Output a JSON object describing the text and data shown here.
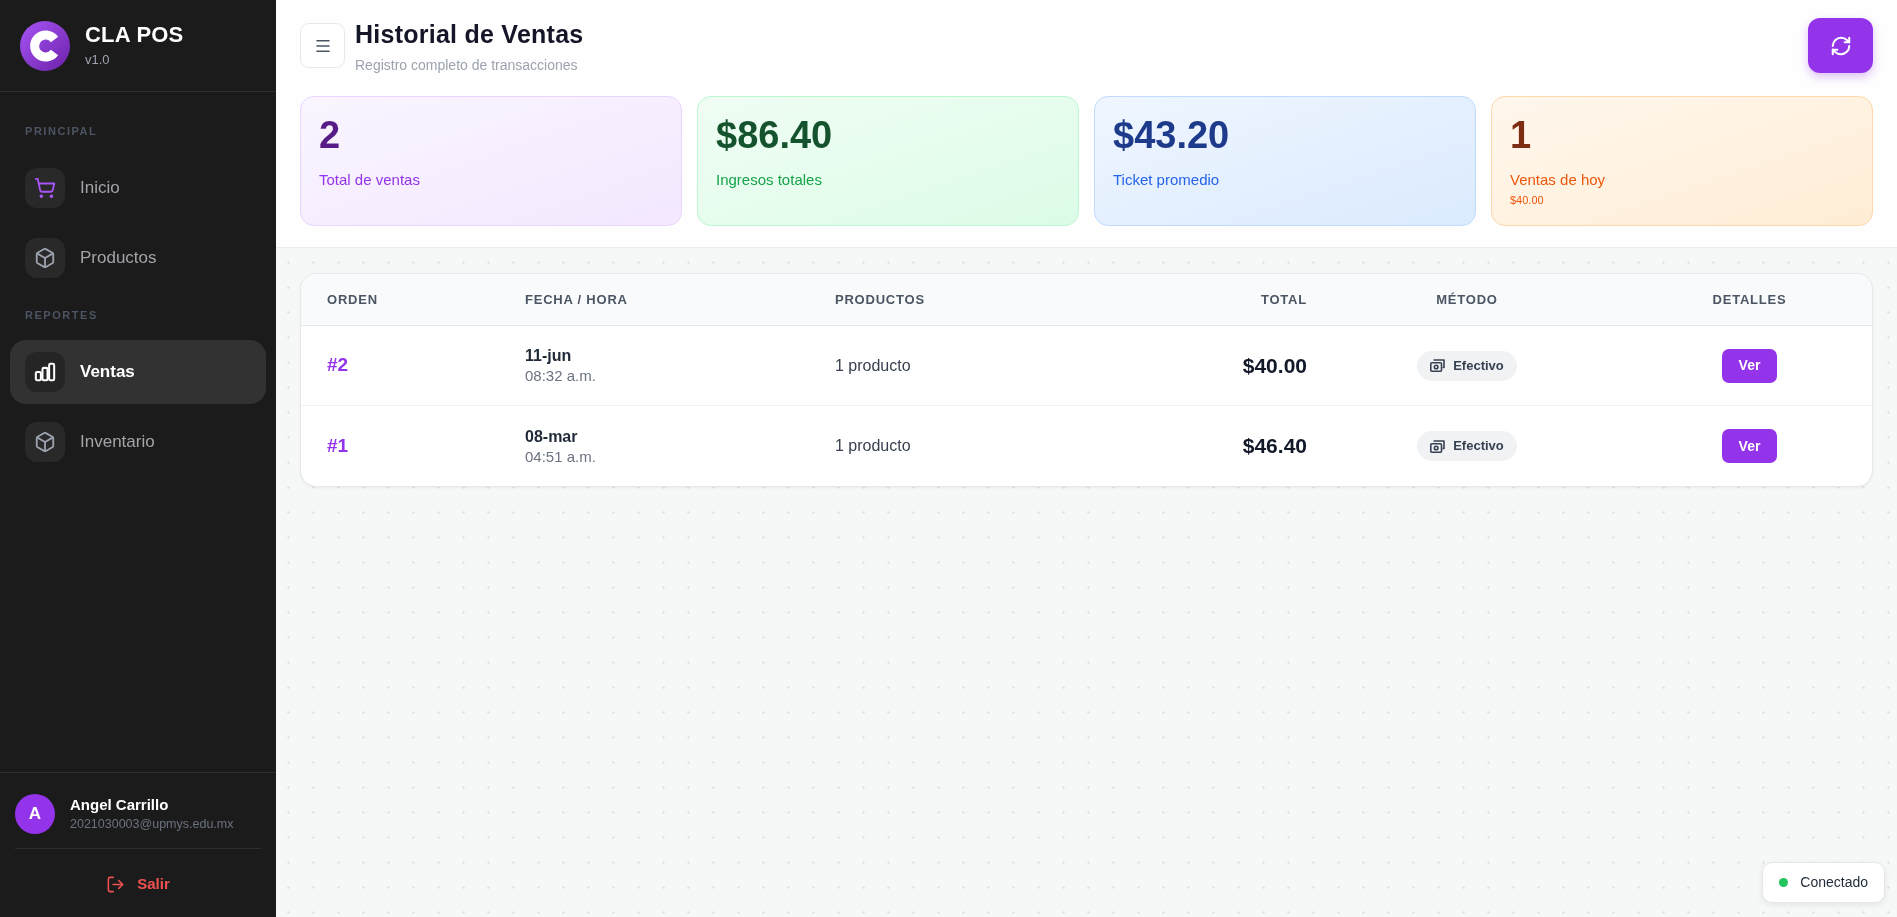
{
  "sidebar": {
    "brand": {
      "name": "CLA POS",
      "version": "v1.0"
    },
    "sections": [
      {
        "title": "PRINCIPAL",
        "items": [
          {
            "label": "Inicio",
            "selected": false
          },
          {
            "label": "Productos",
            "selected": false
          }
        ]
      },
      {
        "title": "REPORTES",
        "items": [
          {
            "label": "Ventas",
            "selected": true
          },
          {
            "label": "Inventario",
            "selected": false
          }
        ]
      }
    ],
    "user": {
      "initial": "A",
      "name": "Angel Carrillo",
      "email": "2021030003@upmys.edu.mx"
    },
    "logout": "Salir"
  },
  "header": {
    "title": "Historial de Ventas",
    "subtitle": "Registro completo de transacciones"
  },
  "stats": [
    {
      "value": "2",
      "label": "Total de ventas",
      "color": "#9333ea"
    },
    {
      "value": "$86.40",
      "label": "Ingresos totales",
      "color": "#16a34a"
    },
    {
      "value": "$43.20",
      "label": "Ticket promedio",
      "color": "#2563eb"
    },
    {
      "value": "1",
      "label": "Ventas de hoy",
      "color": "#ea580c",
      "note": "$40.00"
    }
  ],
  "table": {
    "columns": [
      "ORDEN",
      "FECHA / HORA",
      "PRODUCTOS",
      "TOTAL",
      "MÉTODO",
      "DETALLES"
    ],
    "rows": [
      {
        "order": "#2",
        "date": "11-jun",
        "time": "08:32 a.m.",
        "products": "1 producto",
        "total": "$40.00",
        "method": "Efectivo",
        "action": "Ver"
      },
      {
        "order": "#1",
        "date": "08-mar",
        "time": "04:51 a.m.",
        "products": "1 producto",
        "total": "$46.40",
        "method": "Efectivo",
        "action": "Ver"
      }
    ]
  },
  "status": {
    "label": "Conectado",
    "connected": true
  }
}
